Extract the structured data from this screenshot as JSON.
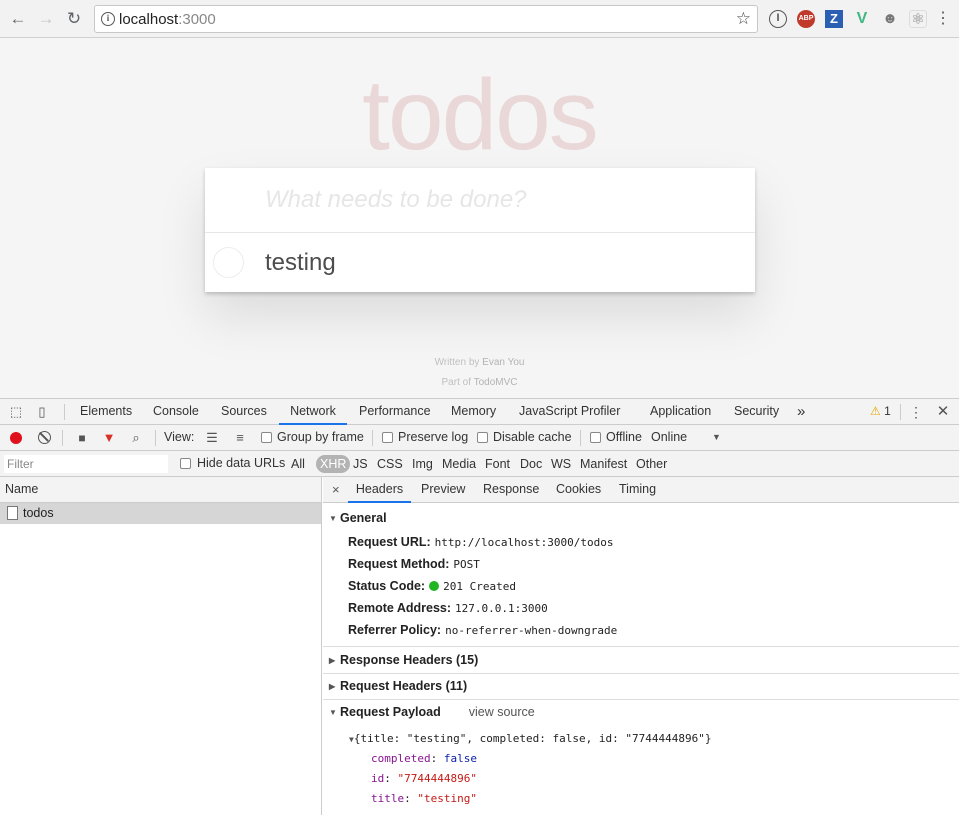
{
  "browser": {
    "url_host": "localhost",
    "url_port": ":3000",
    "ext_abp": "ABP",
    "ext_z": "Z",
    "ext_vue": "V"
  },
  "app": {
    "title": "todos",
    "new_todo_placeholder": "What needs to be done?",
    "items": [
      {
        "label": "testing"
      }
    ],
    "footer_written_prefix": "Written by ",
    "footer_author": "Evan You",
    "footer_part_prefix": "Part of ",
    "footer_part_link": "TodoMVC"
  },
  "devtools": {
    "tabs": [
      "Elements",
      "Console",
      "Sources",
      "Network",
      "Performance",
      "Memory",
      "JavaScript Profiler",
      "Application",
      "Security"
    ],
    "more": "»",
    "warning_count": "1",
    "toolbar": {
      "view_label": "View:",
      "group_by_frame": "Group by frame",
      "preserve_log": "Preserve log",
      "disable_cache": "Disable cache",
      "offline": "Offline",
      "throttle": "Online"
    },
    "filter": {
      "placeholder": "Filter",
      "hide_data_urls": "Hide data URLs",
      "types": [
        "All",
        "XHR",
        "JS",
        "CSS",
        "Img",
        "Media",
        "Font",
        "Doc",
        "WS",
        "Manifest",
        "Other"
      ],
      "active_type": "XHR"
    },
    "requests": {
      "header": "Name",
      "rows": [
        {
          "name": "todos"
        }
      ]
    },
    "detail": {
      "close": "×",
      "tabs": [
        "Headers",
        "Preview",
        "Response",
        "Cookies",
        "Timing"
      ],
      "general_label": "General",
      "general": [
        {
          "key": "Request URL:",
          "value": "http://localhost:3000/todos"
        },
        {
          "key": "Request Method:",
          "value": "POST"
        },
        {
          "key": "Status Code:",
          "value": "201 Created"
        },
        {
          "key": "Remote Address:",
          "value": "127.0.0.1:3000"
        },
        {
          "key": "Referrer Policy:",
          "value": "no-referrer-when-downgrade"
        }
      ],
      "response_headers_label": "Response Headers (15)",
      "request_headers_label": "Request Headers (11)",
      "payload_label": "Request Payload",
      "view_source": "view source",
      "payload_summary": "{title: \"testing\", completed: false, id: \"7744444896\"}",
      "payload_fields": [
        {
          "key": "completed",
          "value": "false",
          "kind": "bool"
        },
        {
          "key": "id",
          "value": "\"7744444896\"",
          "kind": "str"
        },
        {
          "key": "title",
          "value": "\"testing\"",
          "kind": "str"
        }
      ]
    }
  }
}
